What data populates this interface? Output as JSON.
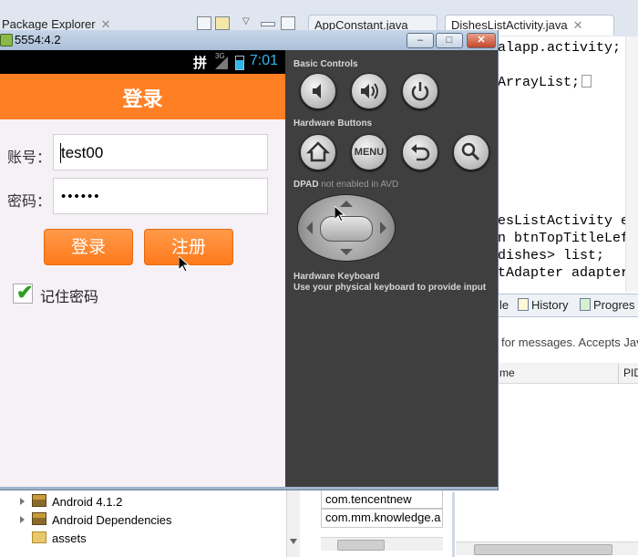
{
  "ide": {
    "tabs": {
      "package_explorer": "Package Explorer",
      "app_constant": "AppConstant.java",
      "dishes_list": "DishesListActivity.java"
    },
    "code_lines": [
      "alapp.activity;",
      "ArrayList;",
      "esListActivity ext",
      "n btnTopTitleLeft,",
      "dishes> list;",
      "tAdapter adapter;"
    ],
    "code_keywords": [
      "ext"
    ],
    "bottom_tabs": {
      "le": "le",
      "history": "History",
      "progress": "Progres"
    },
    "console_hint": "for messages. Accepts Jav",
    "table_headers": {
      "name": "me",
      "pid": "PID"
    },
    "package_tree": [
      {
        "label": "Android 4.1.2",
        "kind": "library"
      },
      {
        "label": "Android Dependencies",
        "kind": "library"
      },
      {
        "label": "assets",
        "kind": "folder"
      }
    ],
    "outline_rows": [
      "com.tencentnew",
      "com.mm.knowledge.a"
    ]
  },
  "emulator": {
    "window_title": "5554:4.2",
    "window_buttons": {
      "minimize": "–",
      "maximize": "□",
      "close": "✕"
    },
    "status_bar": {
      "ime": "拼",
      "network": "3G",
      "time": "7:01"
    },
    "app": {
      "title": "登录",
      "account_label": "账号：",
      "account_value": "test00",
      "password_label": "密码：",
      "password_value": "••••••",
      "login_button": "登录",
      "register_button": "注册",
      "remember_label": "记住密码",
      "remember_checked": true,
      "accent_color": "#ff7f24"
    },
    "controls": {
      "basic_controls": "Basic Controls",
      "hardware_buttons": "Hardware Buttons",
      "dpad": "DPAD",
      "dpad_note": "not enabled in AVD",
      "keyboard_title": "Hardware Keyboard",
      "keyboard_hint": "Use your physical keyboard to provide input",
      "menu_label": "MENU"
    }
  }
}
